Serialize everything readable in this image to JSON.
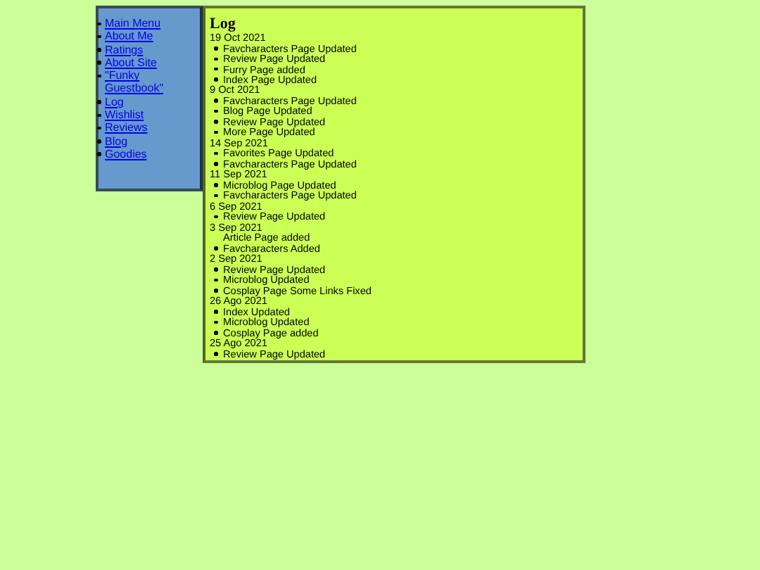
{
  "nav": [
    {
      "label": "Main Menu"
    },
    {
      "label": "About Me"
    },
    {
      "label": "Ratings"
    },
    {
      "label": "About Site"
    },
    {
      "label": "\"Funky Guestbook\""
    },
    {
      "label": "Log"
    },
    {
      "label": "Wishlist"
    },
    {
      "label": "Reviews"
    },
    {
      "label": "Blog"
    },
    {
      "label": "Goodies"
    }
  ],
  "log": {
    "title": "Log",
    "entries": [
      {
        "date": "19 Oct 2021",
        "items": [
          {
            "text": "Favcharacters Page Updated",
            "bullet": true
          },
          {
            "text": "Review Page Updated",
            "bullet": true
          },
          {
            "text": "Furry Page added",
            "bullet": true
          },
          {
            "text": "Index Page Updated",
            "bullet": true
          }
        ]
      },
      {
        "date": "9 Oct 2021",
        "items": [
          {
            "text": "Favcharacters Page Updated",
            "bullet": true
          },
          {
            "text": "Blog Page Updated",
            "bullet": true
          },
          {
            "text": "Review Page Updated",
            "bullet": true
          },
          {
            "text": "More Page Updated",
            "bullet": true
          }
        ]
      },
      {
        "date": "14 Sep 2021",
        "items": [
          {
            "text": "Favorites Page Updated",
            "bullet": true
          },
          {
            "text": "Favcharacters Page Updated",
            "bullet": true
          }
        ]
      },
      {
        "date": "11 Sep 2021",
        "items": [
          {
            "text": "Microblog Page Updated",
            "bullet": true
          },
          {
            "text": "Favcharacters Page Updated",
            "bullet": true
          }
        ]
      },
      {
        "date": "6 Sep 2021",
        "items": [
          {
            "text": "Review Page Updated",
            "bullet": true
          }
        ]
      },
      {
        "date": "3 Sep 2021",
        "items": [
          {
            "text": "Article Page added",
            "bullet": false
          },
          {
            "text": "Favcharacters Added",
            "bullet": true
          }
        ]
      },
      {
        "date": "2 Sep 2021",
        "items": [
          {
            "text": "Review Page Updated",
            "bullet": true
          },
          {
            "text": "Microblog Updated",
            "bullet": true
          },
          {
            "text": "Cosplay Page Some Links Fixed",
            "bullet": true
          }
        ]
      },
      {
        "date": "26 Ago 2021",
        "items": [
          {
            "text": "Index Updated",
            "bullet": true
          },
          {
            "text": "Microblog Updated",
            "bullet": true
          },
          {
            "text": "Cosplay Page added",
            "bullet": true
          }
        ]
      },
      {
        "date": "25 Ago 2021",
        "items": [
          {
            "text": "Review Page Updated",
            "bullet": true
          }
        ]
      }
    ]
  }
}
